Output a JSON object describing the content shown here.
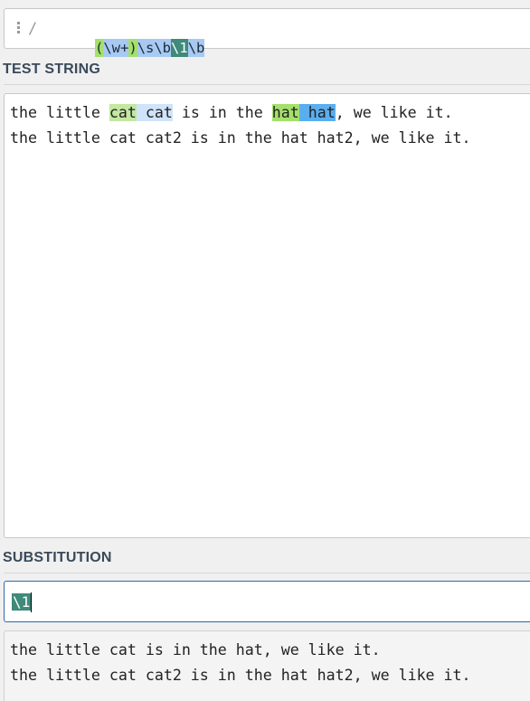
{
  "regex": {
    "delimiter": "/",
    "tokens": [
      {
        "text": "(",
        "kind": "group"
      },
      {
        "text": "\\w+",
        "kind": "class"
      },
      {
        "text": ")",
        "kind": "group"
      },
      {
        "text": "\\s\\b",
        "kind": "class"
      },
      {
        "text": "\\1",
        "kind": "backref"
      },
      {
        "text": "\\b",
        "kind": "class"
      }
    ]
  },
  "test_string": {
    "label": "TEST STRING",
    "lines": [
      [
        {
          "text": "the little ",
          "hl": ""
        },
        {
          "text": "cat",
          "hl": "m-group"
        },
        {
          "text": " cat",
          "hl": "m-rest"
        },
        {
          "text": " is in the ",
          "hl": ""
        },
        {
          "text": "hat",
          "hl": "m-group-strong"
        },
        {
          "text": " hat",
          "hl": "m-rest-strong"
        },
        {
          "text": ", we like it.",
          "hl": ""
        }
      ],
      [
        {
          "text": "the little cat cat2 is in the hat hat2, we like it.",
          "hl": ""
        }
      ]
    ]
  },
  "substitution": {
    "label": "SUBSTITUTION",
    "value": "\\1"
  },
  "result": {
    "lines": [
      "the little cat is in the hat, we like it.",
      "the little cat cat2 is in the hat hat2, we like it."
    ]
  },
  "colors": {
    "group": "#a5e06a",
    "class": "#a7c9f2",
    "backref": "#3f8a7a",
    "focus_border": "#2e6aa8"
  }
}
